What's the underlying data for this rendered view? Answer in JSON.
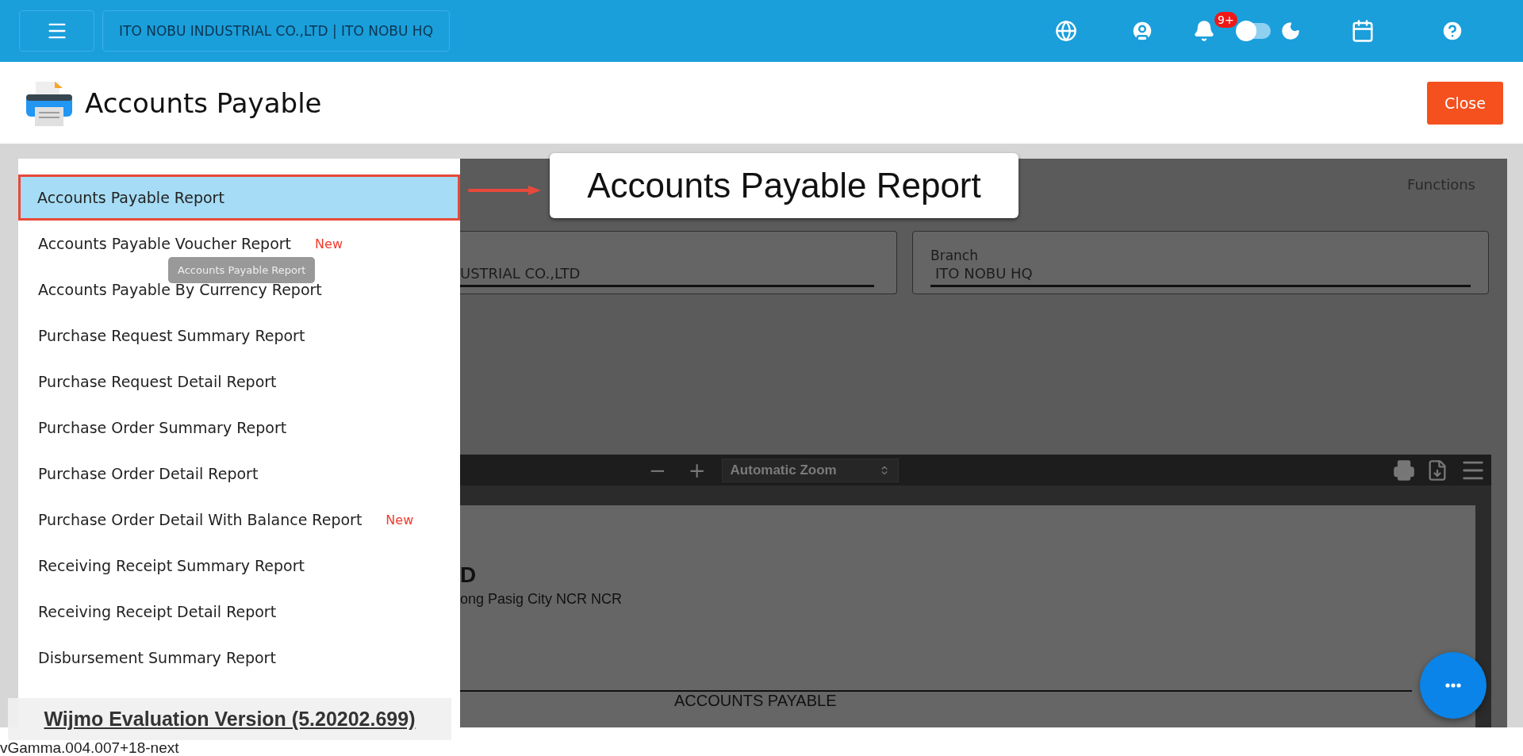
{
  "topbar": {
    "company": "ITO NOBU INDUSTRIAL CO.,LTD | ITO NOBU HQ",
    "notification_badge": "9+",
    "dark_mode": {
      "on": false
    }
  },
  "header": {
    "title": "Accounts Payable",
    "close_button": "Close"
  },
  "report_menu": {
    "items": [
      {
        "label": "Accounts Payable Report",
        "selected": true
      },
      {
        "label": "Accounts Payable Voucher Report",
        "selected": false,
        "badge": "New"
      },
      {
        "label": "Accounts Payable By Currency Report",
        "selected": false
      },
      {
        "label": "Purchase Request Summary Report",
        "selected": false
      },
      {
        "label": "Purchase Request Detail Report",
        "selected": false
      },
      {
        "label": "Purchase Order Summary Report",
        "selected": false
      },
      {
        "label": "Purchase Order Detail Report",
        "selected": false
      },
      {
        "label": "Purchase Order Detail With Balance Report",
        "selected": false,
        "badge": "New"
      },
      {
        "label": "Receiving Receipt Summary Report",
        "selected": false
      },
      {
        "label": "Receiving Receipt Detail Report",
        "selected": false
      },
      {
        "label": "Disbursement Summary Report",
        "selected": false
      }
    ]
  },
  "tooltip": "Accounts Payable Report",
  "callout": "Accounts Payable Report",
  "form": {
    "functions": "Functions",
    "company_field": {
      "value": "USTRIAL CO.,LTD"
    },
    "branch_field": {
      "label": "Branch",
      "value": "ITO NOBU HQ"
    }
  },
  "pdf_viewer": {
    "zoom_out": "−",
    "zoom_in": "+",
    "zoom_select": "Automatic Zoom",
    "page_lines": [
      "D",
      "ong  Pasig City NCR NCR",
      "ACCOUNTS PAYABLE"
    ]
  },
  "eval_banner": "Wijmo Evaluation Version (5.20202.699)",
  "version": "vGamma.004.007+18-next"
}
